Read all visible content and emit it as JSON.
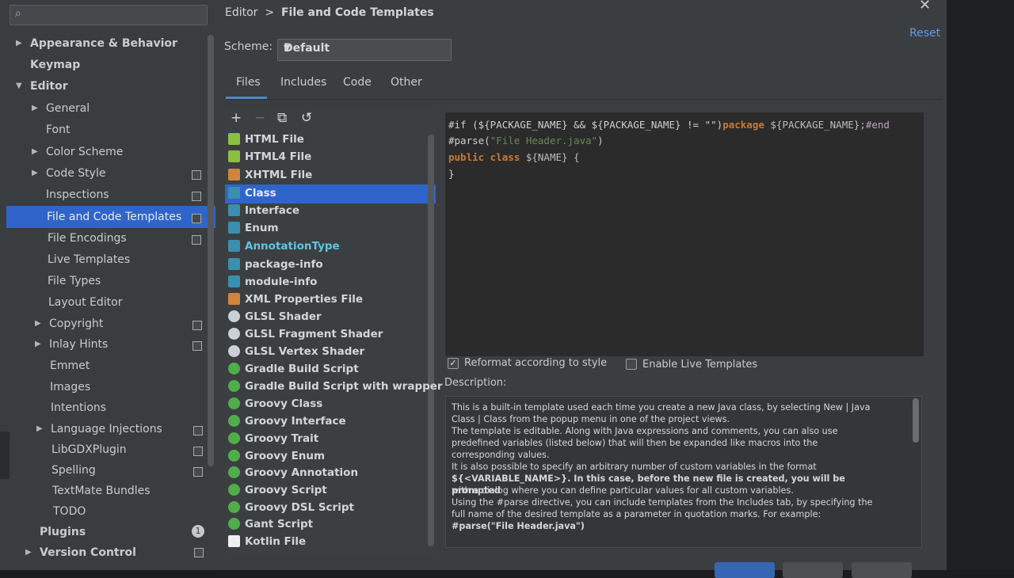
{
  "search": {
    "placeholder": ""
  },
  "sidebar": {
    "items": [
      {
        "label": "Appearance & Behavior",
        "bold": true
      },
      {
        "label": "Keymap",
        "bold": true
      },
      {
        "label": "Editor",
        "bold": true
      },
      {
        "label": "General"
      },
      {
        "label": "Font"
      },
      {
        "label": "Color Scheme"
      },
      {
        "label": "Code Style"
      },
      {
        "label": "Inspections"
      },
      {
        "label": "File and Code Templates"
      },
      {
        "label": "File Encodings"
      },
      {
        "label": "Live Templates"
      },
      {
        "label": "File Types"
      },
      {
        "label": "Layout Editor"
      },
      {
        "label": "Copyright"
      },
      {
        "label": "Inlay Hints"
      },
      {
        "label": "Emmet"
      },
      {
        "label": "Images"
      },
      {
        "label": "Intentions"
      },
      {
        "label": "Language Injections"
      },
      {
        "label": "LibGDXPlugin"
      },
      {
        "label": "Spelling"
      },
      {
        "label": "TextMate Bundles"
      },
      {
        "label": "TODO"
      },
      {
        "label": "Plugins",
        "bold": true
      },
      {
        "label": "Version Control",
        "bold": true
      }
    ],
    "plugins_badge": "1"
  },
  "breadcrumb": {
    "parent": "Editor",
    "separator": ">",
    "current": "File and Code Templates"
  },
  "reset_label": "Reset",
  "scheme": {
    "label": "Scheme:",
    "value": "Default"
  },
  "tabs": [
    "Files",
    "Includes",
    "Code",
    "Other"
  ],
  "toolbar": {
    "add": "+",
    "remove": "−",
    "copy": "⧉",
    "reset": "↺"
  },
  "templates": [
    {
      "name": "HTML File",
      "icon": "html"
    },
    {
      "name": "HTML4 File",
      "icon": "html"
    },
    {
      "name": "XHTML File",
      "icon": "xml"
    },
    {
      "name": "Class",
      "icon": "java"
    },
    {
      "name": "Interface",
      "icon": "java"
    },
    {
      "name": "Enum",
      "icon": "java"
    },
    {
      "name": "AnnotationType",
      "icon": "java"
    },
    {
      "name": "package-info",
      "icon": "java"
    },
    {
      "name": "module-info",
      "icon": "java"
    },
    {
      "name": "XML Properties File",
      "icon": "xml"
    },
    {
      "name": "GLSL Shader",
      "icon": "glsl"
    },
    {
      "name": "GLSL Fragment Shader",
      "icon": "glsl"
    },
    {
      "name": "GLSL Vertex Shader",
      "icon": "glsl"
    },
    {
      "name": "Gradle Build Script",
      "icon": "groovy"
    },
    {
      "name": "Gradle Build Script with wrapper",
      "icon": "groovy"
    },
    {
      "name": "Groovy Class",
      "icon": "groovy"
    },
    {
      "name": "Groovy Interface",
      "icon": "groovy"
    },
    {
      "name": "Groovy Trait",
      "icon": "groovy"
    },
    {
      "name": "Groovy Enum",
      "icon": "groovy"
    },
    {
      "name": "Groovy Annotation",
      "icon": "groovy"
    },
    {
      "name": "Groovy Script",
      "icon": "groovy"
    },
    {
      "name": "Groovy DSL Script",
      "icon": "groovy"
    },
    {
      "name": "Gant Script",
      "icon": "groovy"
    },
    {
      "name": "Kotlin File",
      "icon": "kotlin"
    }
  ],
  "editor": {
    "line1a": "#if (${PACKAGE_NAME} && ${PACKAGE_NAME} != \"\")",
    "line1b": "package",
    "line1c": " ${PACKAGE_NAME};",
    "line1d": "#end",
    "line2a": "#parse(",
    "line2b": "\"File Header.java\"",
    "line2c": ")",
    "line3a": "public class",
    "line3b": " ${NAME} {",
    "line4": "}"
  },
  "options": {
    "reformat": "Reformat according to style",
    "reformat_checked": true,
    "live": "Enable Live Templates",
    "live_checked": false
  },
  "description": {
    "label": "Description:",
    "lines": [
      "This is a built-in template used each time you create a new Java class, by selecting New | Java",
      "Class | Class from the popup menu in one of the project views.",
      "The template is editable. Along with Java expressions and comments, you can also use",
      "predefined variables (listed below) that will then be expanded like macros into the",
      "corresponding values.",
      "It is also possible to specify an arbitrary number of custom variables in the format",
      "${<VARIABLE_NAME>}. In this case, before the new file is created, you will be prompted",
      "with a dialog where you can define particular values for all custom variables.",
      "Using the #parse directive, you can include templates from the Includes tab, by specifying the",
      "full name of the desired template as a parameter in quotation marks. For example:",
      "#parse(\"File Header.java\")"
    ]
  }
}
